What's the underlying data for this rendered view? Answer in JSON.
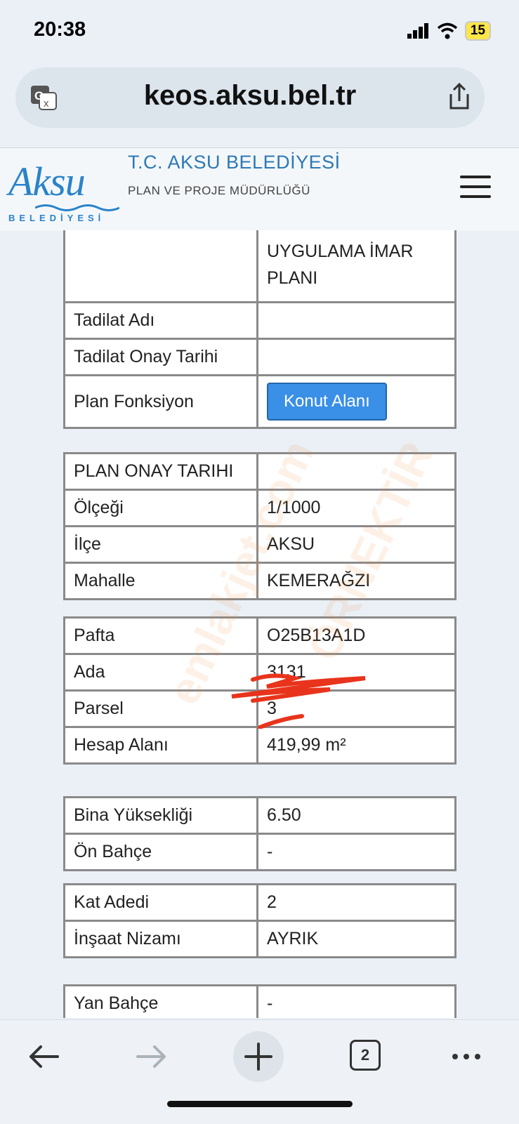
{
  "status": {
    "time": "20:38",
    "battery": "15"
  },
  "browser": {
    "url": "keos.aksu.bel.tr",
    "tabs_count": "2"
  },
  "site": {
    "logo_text": "Aksu",
    "logo_sub": "BELEDİYESİ",
    "title": "T.C. AKSU BELEDİYESİ",
    "subtitle": "PLAN VE PROJE MÜDÜRLÜĞÜ"
  },
  "plan_table": {
    "rows": [
      {
        "key": "",
        "value_line1": "UYGULAMA İMAR",
        "value_line2": "PLANI"
      },
      {
        "key": "Tadilat Adı",
        "value": ""
      },
      {
        "key": "Tadilat Onay Tarihi",
        "value": ""
      },
      {
        "key": "Plan Fonksiyon",
        "button": "Konut Alanı"
      }
    ]
  },
  "location_table": {
    "rows": [
      {
        "key": "PLAN ONAY TARIHI",
        "value": ""
      },
      {
        "key": "Ölçeği",
        "value": "1/1000"
      },
      {
        "key": "İlçe",
        "value": "AKSU"
      },
      {
        "key": "Mahalle",
        "value": "KEMERAĞZI"
      }
    ]
  },
  "parcel_table": {
    "rows": [
      {
        "key": "Pafta",
        "value": "O25B13A1D"
      },
      {
        "key": "Ada",
        "value": "3131"
      },
      {
        "key": "Parsel",
        "value": "3"
      },
      {
        "key": "Hesap Alanı",
        "value": "419,99 m²"
      }
    ]
  },
  "height_table": {
    "rows": [
      {
        "key": "Bina Yüksekliği",
        "value": "6.50"
      },
      {
        "key": "Ön Bahçe",
        "value": "-"
      }
    ]
  },
  "floor_table": {
    "rows": [
      {
        "key": "Kat Adedi",
        "value": "2"
      },
      {
        "key": "İnşaat Nizamı",
        "value": "AYRIK"
      }
    ]
  },
  "side_table": {
    "rows": [
      {
        "key": "Yan Bahçe",
        "value": "-"
      }
    ]
  },
  "watermark": {
    "text1": "emlakjet.com",
    "text2": "ÖRNEKTİR"
  },
  "colors": {
    "brand_blue": "#2a83c9",
    "button_blue": "#3a8fe6",
    "scribble_red": "#e8341c"
  }
}
